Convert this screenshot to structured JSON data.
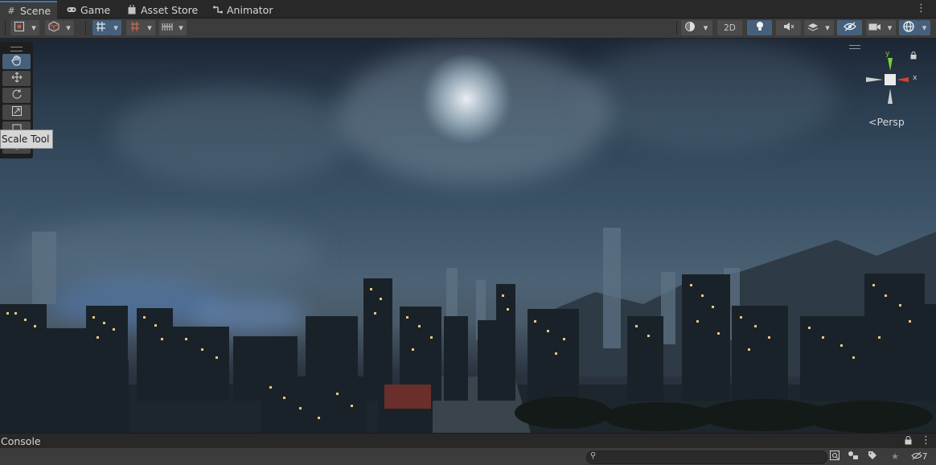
{
  "tabs": [
    {
      "label": "Scene",
      "icon": "grid-icon"
    },
    {
      "label": "Game",
      "icon": "gamepad-icon"
    },
    {
      "label": "Asset Store",
      "icon": "shopping-bag-icon"
    },
    {
      "label": "Animator",
      "icon": "animator-icon"
    }
  ],
  "scene_toolbar": {
    "mode_2d_label": "2D"
  },
  "tooltip": {
    "text": "Scale Tool"
  },
  "gizmo": {
    "persp_label": "Persp",
    "y_label": "y",
    "x_label": "x"
  },
  "console": {
    "title": "Console",
    "search_placeholder": "",
    "hidden_count": "7"
  },
  "colors": {
    "accent_blue": "#3a79bb",
    "active_toggle": "#46607c",
    "gizmo_y": "#7bd13a",
    "gizmo_x": "#d9412b"
  }
}
